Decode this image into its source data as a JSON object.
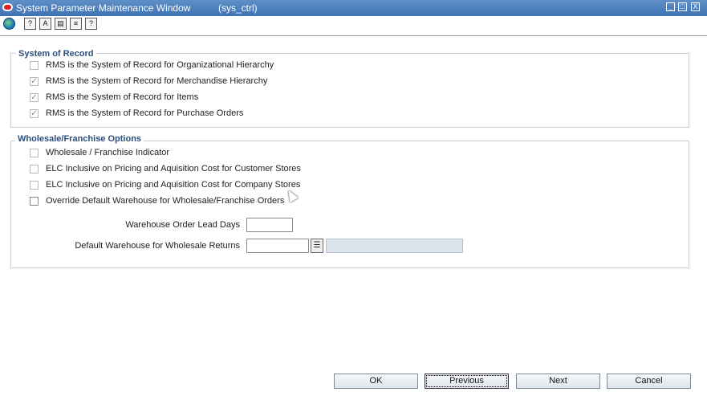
{
  "window": {
    "title": "System Parameter Maintenance Window",
    "subtitle": "(sys_ctrl)",
    "minimize": "_",
    "maximize": "□",
    "close": "X"
  },
  "toolbar": {
    "buttons": [
      {
        "name": "globe-icon",
        "glyph": ""
      },
      {
        "name": "help-circle-icon",
        "glyph": "?"
      },
      {
        "name": "find-icon",
        "glyph": "A"
      },
      {
        "name": "notes-icon",
        "glyph": "▤"
      },
      {
        "name": "print-icon",
        "glyph": "≡"
      },
      {
        "name": "help-icon",
        "glyph": "?"
      }
    ]
  },
  "system_of_record": {
    "legend": "System of Record",
    "items": [
      {
        "label": "RMS is the System of Record for Organizational Hierarchy",
        "checked": false
      },
      {
        "label": "RMS is the System of Record for Merchandise Hierarchy",
        "checked": true
      },
      {
        "label": "RMS is the System of Record for Items",
        "checked": true
      },
      {
        "label": "RMS is the System of Record for Purchase Orders",
        "checked": true
      }
    ]
  },
  "wholesale": {
    "legend": "Wholesale/Franchise Options",
    "items": [
      {
        "label": "Wholesale / Franchise Indicator",
        "checked": false
      },
      {
        "label": "ELC Inclusive on Pricing and Aquisition Cost for Customer Stores",
        "checked": false
      },
      {
        "label": "ELC Inclusive on Pricing and Aquisition Cost for Company Stores",
        "checked": false
      },
      {
        "label": "Override Default Warehouse for Wholesale/Franchise Orders",
        "checked": false
      }
    ],
    "lead_days_label": "Warehouse Order Lead Days",
    "lead_days_value": "",
    "default_wh_label": "Default Warehouse for Wholesale Returns",
    "default_wh_value": "",
    "default_wh_desc": ""
  },
  "buttons": {
    "ok": "OK",
    "previous": "Previous",
    "next": "Next",
    "cancel": "Cancel"
  }
}
